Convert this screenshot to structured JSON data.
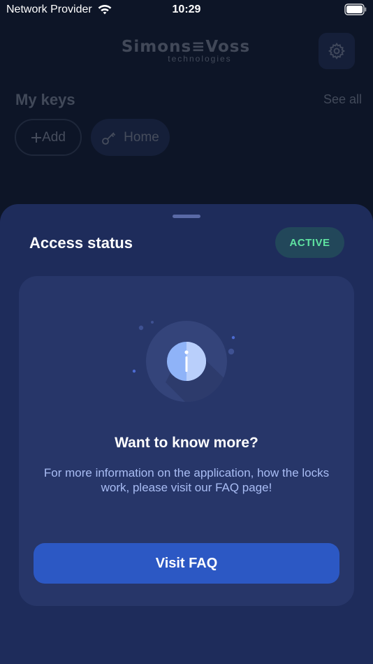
{
  "status_bar": {
    "carrier": "Network Provider",
    "time": "10:29"
  },
  "background": {
    "logo_main": "Simons≡Voss",
    "logo_sub": "technologies",
    "section_title": "My keys",
    "see_all_label": "See all",
    "add_label": "Add",
    "home_label": "Home",
    "icons": [
      "gear-icon",
      "plus-icon",
      "key-icon"
    ]
  },
  "sheet": {
    "title": "Access status",
    "status_badge": "ACTIVE",
    "card": {
      "heading": "Want to know more?",
      "body": "For more information on the application, how the locks work, please visit our FAQ page!",
      "button_label": "Visit FAQ",
      "illustration_icon": "info-icon"
    }
  },
  "colors": {
    "background": "#0d1527",
    "sheet": "#1e2c5b",
    "card": "#273669",
    "accent_button": "#2c58c4",
    "active_text": "#5fe3a1",
    "active_badge_bg": "#22475a",
    "body_text": "#a9bdf4"
  }
}
